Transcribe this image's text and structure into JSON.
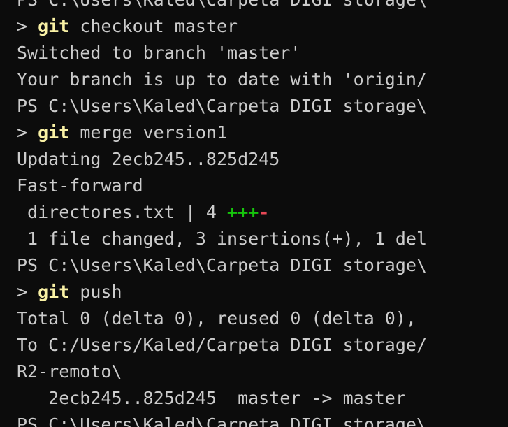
{
  "terminal": {
    "colors": {
      "background": "#0c0c0c",
      "foreground": "#cccccc",
      "command": "#f9f1a5",
      "insertion": "#16c60c",
      "deletion": "#e74856"
    },
    "lines": [
      "PS C:\\Users\\Kaled\\Carpeta DIGI storage\\",
      {
        "prompt": "> ",
        "cmd": "git",
        "args": " checkout master"
      },
      "Switched to branch 'master'",
      "Your branch is up to date with 'origin/",
      "PS C:\\Users\\Kaled\\Carpeta DIGI storage\\",
      {
        "prompt": "> ",
        "cmd": "git",
        "args": " merge version1"
      },
      "Updating 2ecb245..825d245",
      "Fast-forward",
      {
        "text": " directores.txt | 4 ",
        "plus": "+++",
        "minus": "-"
      },
      " 1 file changed, 3 insertions(+), 1 del",
      "PS C:\\Users\\Kaled\\Carpeta DIGI storage\\",
      {
        "prompt": "> ",
        "cmd": "git",
        "args": " push"
      },
      "Total 0 (delta 0), reused 0 (delta 0), ",
      "To C:/Users/Kaled/Carpeta DIGI storage/",
      "R2-remoto\\",
      "   2ecb245..825d245  master -> master",
      "PS C:\\Users\\Kaled\\Carpeta DIGI storage\\"
    ]
  }
}
